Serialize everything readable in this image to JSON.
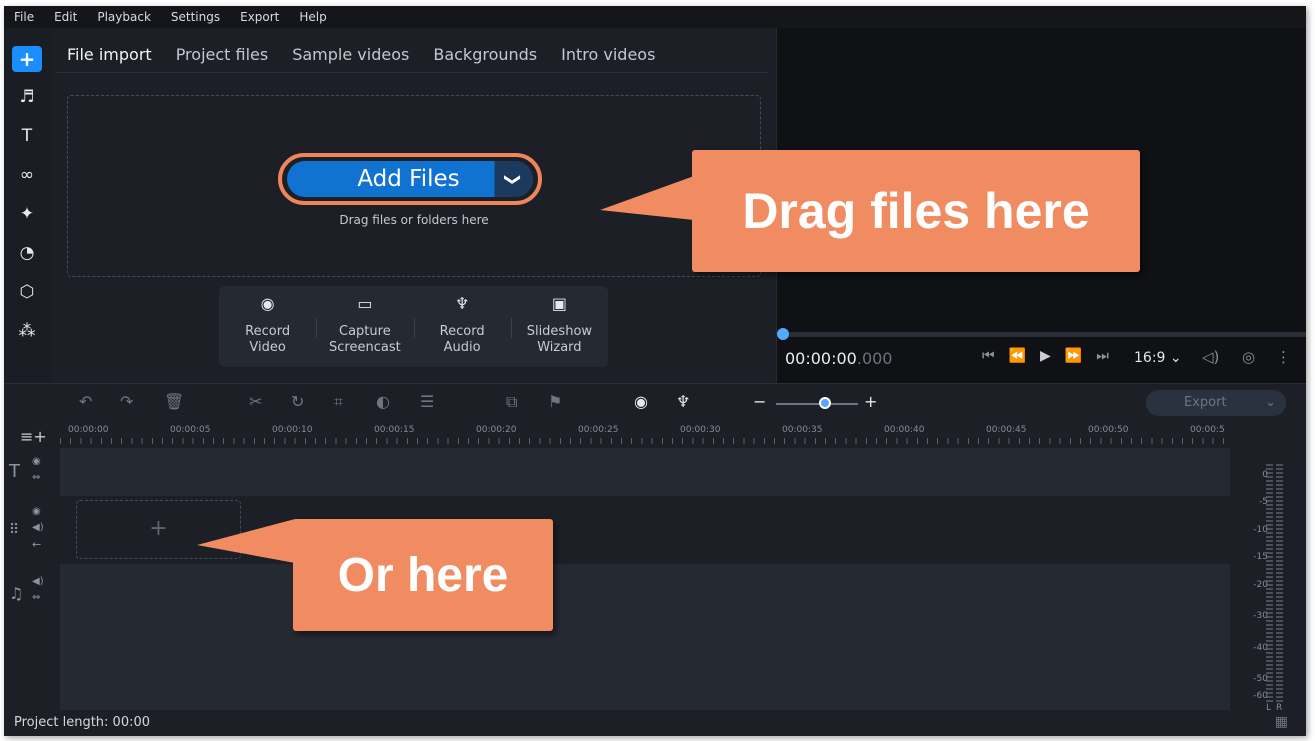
{
  "menu": [
    "File",
    "Edit",
    "Playback",
    "Settings",
    "Export",
    "Help"
  ],
  "left_tools": [
    {
      "icon": "plus-icon",
      "glyph": "+"
    },
    {
      "icon": "music-note-icon",
      "glyph": "♬"
    },
    {
      "icon": "text-icon",
      "glyph": "T"
    },
    {
      "icon": "transitions-icon",
      "glyph": "∞"
    },
    {
      "icon": "magic-wand-icon",
      "glyph": "✦"
    },
    {
      "icon": "filters-icon",
      "glyph": "◔"
    },
    {
      "icon": "stickers-icon",
      "glyph": "⬡"
    },
    {
      "icon": "more-tools-icon",
      "glyph": "⁂"
    }
  ],
  "import_tabs": [
    "File import",
    "Project files",
    "Sample videos",
    "Backgrounds",
    "Intro videos"
  ],
  "add_files": {
    "label": "Add Files",
    "chevron": "❯",
    "hint": "Drag files or folders here"
  },
  "actions": [
    {
      "glyph": "◉",
      "icon": "webcam-icon",
      "line1": "Record",
      "line2": "Video"
    },
    {
      "glyph": "▭",
      "icon": "screen-icon",
      "line1": "Capture",
      "line2": "Screencast"
    },
    {
      "glyph": "♆",
      "icon": "microphone-icon",
      "line1": "Record",
      "line2": "Audio"
    },
    {
      "glyph": "▣",
      "icon": "slideshow-icon",
      "line1": "Slideshow",
      "line2": "Wizard"
    }
  ],
  "player": {
    "time_main": "00:00:00",
    "time_ms": ".000",
    "controls": [
      "⏮",
      "⏪",
      "▶",
      "⏩",
      "⏭"
    ],
    "aspect": "16:9 ⌄",
    "volume_glyph": "◁)",
    "snapshot_glyph": "◎",
    "more_glyph": "⋮",
    "position": 0
  },
  "timeline_toolbar": {
    "undo": "↶",
    "redo": "↷",
    "delete": "🗑",
    "cut": "✂",
    "rotate": "↻",
    "crop": "⌗",
    "color": "◐",
    "properties": "☰",
    "overlay": "⧉",
    "marker": "⚑",
    "webcam": "◉",
    "mic": "♆",
    "zoom_minus": "−",
    "zoom_plus": "+",
    "zoom_level": 0.6,
    "export_label": "Export",
    "export_chevron": "⌄"
  },
  "ruler_ticks": [
    "00:00:00",
    "00:00:05",
    "00:00:10",
    "00:00:15",
    "00:00:20",
    "00:00:25",
    "00:00:30",
    "00:00:35",
    "00:00:40",
    "00:00:45",
    "00:00:50",
    "00:00:5"
  ],
  "track_icons": {
    "text_track": "T",
    "video_track": "⠿",
    "audio_track": "♫",
    "eye": "◉",
    "speaker": "◀)",
    "link": "⇔",
    "arrow": "←",
    "add": "+"
  },
  "meter_labels": [
    "0",
    "-5",
    "-10",
    "-15",
    "-20",
    "-30",
    "-40",
    "-50",
    "-60"
  ],
  "meter_channels": [
    "L",
    "R"
  ],
  "status": {
    "project_length": "Project length: 00:00"
  },
  "callouts": {
    "drag_here": "Drag files here",
    "or_here": "Or here"
  },
  "colors": {
    "accent": "#1a8dff",
    "callout": "#f18b61",
    "add_button": "#1073d2",
    "background": "#1c1f26"
  }
}
